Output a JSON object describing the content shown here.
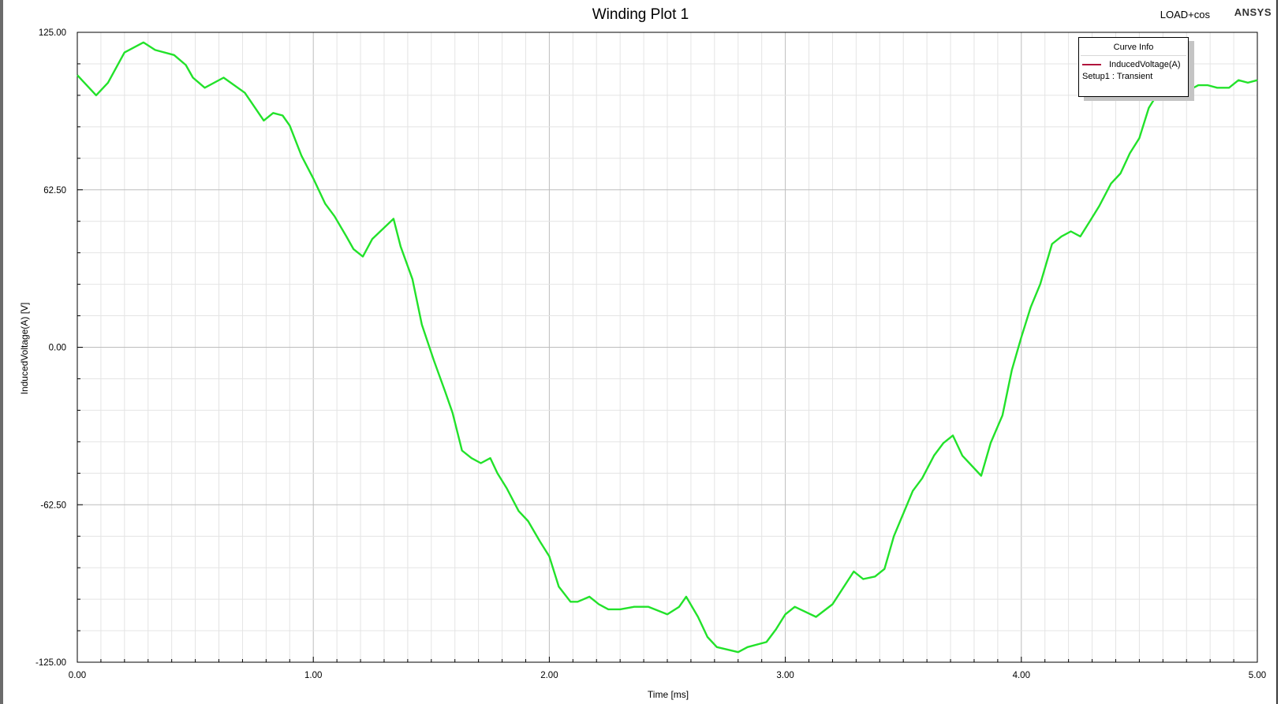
{
  "design": "LOAD+cos",
  "brand": "ANSYS",
  "legend": {
    "title": "Curve Info",
    "series_name": "InducedVoltage(A)",
    "setup": "Setup1 : Transient",
    "swatch_color": "#b0143c"
  },
  "chart_data": {
    "type": "line",
    "title": "Winding Plot 1",
    "xlabel": "Time [ms]",
    "ylabel": "InducedVoltage(A) [V]",
    "xlim": [
      0,
      5
    ],
    "ylim": [
      -125,
      125
    ],
    "xticks": [
      "0.00",
      "1.00",
      "2.00",
      "3.00",
      "4.00",
      "5.00"
    ],
    "yticks": [
      "125.00",
      "62.50",
      "0.00",
      "-62.50",
      "-125.00"
    ],
    "grid": true,
    "line_color": "#22e22a",
    "series": [
      {
        "x": [
          0.0,
          0.08,
          0.13,
          0.2,
          0.28,
          0.33,
          0.41,
          0.46,
          0.49,
          0.54,
          0.62,
          0.71,
          0.79,
          0.83,
          0.87,
          0.9,
          0.95,
          1.0,
          1.05,
          1.09,
          1.14,
          1.17,
          1.21,
          1.25,
          1.34,
          1.37,
          1.42,
          1.46,
          1.51,
          1.56,
          1.59,
          1.63,
          1.67,
          1.71,
          1.75,
          1.78,
          1.82,
          1.87,
          1.91,
          1.96,
          2.0,
          2.04,
          2.09,
          2.12,
          2.17,
          2.21,
          2.25,
          2.3,
          2.36,
          2.42,
          2.5,
          2.55,
          2.58,
          2.63,
          2.67,
          2.71,
          2.8,
          2.84,
          2.92,
          2.96,
          3.0,
          3.04,
          3.13,
          3.2,
          3.29,
          3.33,
          3.38,
          3.42,
          3.46,
          3.5,
          3.54,
          3.58,
          3.63,
          3.67,
          3.71,
          3.75,
          3.83,
          3.87,
          3.92,
          3.96,
          4.0,
          4.04,
          4.08,
          4.13,
          4.17,
          4.21,
          4.25,
          4.29,
          4.33,
          4.38,
          4.42,
          4.46,
          4.5,
          4.54,
          4.58,
          4.63,
          4.67,
          4.71,
          4.75,
          4.79,
          4.83,
          4.88,
          4.92,
          4.96,
          5.0
        ],
        "y": [
          108,
          100,
          105,
          117,
          121,
          118,
          116,
          112,
          107,
          103,
          107,
          101,
          90,
          93,
          92,
          88,
          76,
          67,
          57,
          52,
          44,
          39,
          36,
          43,
          51,
          40,
          27,
          9,
          -5,
          -18,
          -26,
          -41,
          -44,
          -46,
          -44,
          -50,
          -56,
          -65,
          -69,
          -77,
          -83,
          -95,
          -101,
          -101,
          -99,
          -102,
          -104,
          -104,
          -103,
          -103,
          -106,
          -103,
          -99,
          -107,
          -115,
          -119,
          -121,
          -119,
          -117,
          -112,
          -106,
          -103,
          -107,
          -102,
          -89,
          -92,
          -91,
          -88,
          -75,
          -66,
          -57,
          -52,
          -43,
          -38,
          -35,
          -43,
          -51,
          -38,
          -27,
          -9,
          4,
          16,
          25,
          41,
          44,
          46,
          44,
          50,
          56,
          65,
          69,
          77,
          83,
          95,
          101,
          101,
          99,
          102,
          104,
          104,
          103,
          103,
          106,
          105,
          106
        ]
      }
    ]
  }
}
